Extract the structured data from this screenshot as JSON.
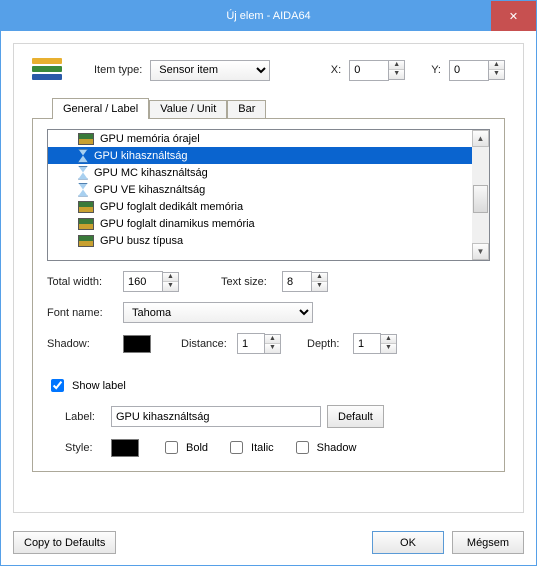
{
  "window": {
    "title": "Új elem - AIDA64"
  },
  "top": {
    "item_type_label": "Item type:",
    "item_type_value": "Sensor item",
    "x_label": "X:",
    "x_value": "0",
    "y_label": "Y:",
    "y_value": "0"
  },
  "tabs": {
    "general": "General / Label",
    "value": "Value / Unit",
    "bar": "Bar"
  },
  "list": {
    "items": [
      {
        "icon": "chip",
        "label": "GPU memória órajel"
      },
      {
        "icon": "hour",
        "label": "GPU kihasználtság",
        "selected": true
      },
      {
        "icon": "hour",
        "label": "GPU MC kihasználtság"
      },
      {
        "icon": "hour",
        "label": "GPU VE kihasználtság"
      },
      {
        "icon": "chip",
        "label": "GPU foglalt dedikált memória"
      },
      {
        "icon": "chip",
        "label": "GPU foglalt dinamikus memória"
      },
      {
        "icon": "chip",
        "label": "GPU busz típusa"
      }
    ]
  },
  "fields": {
    "total_width_label": "Total width:",
    "total_width_value": "160",
    "text_size_label": "Text size:",
    "text_size_value": "8",
    "font_name_label": "Font name:",
    "font_name_value": "Tahoma",
    "shadow_label": "Shadow:",
    "distance_label": "Distance:",
    "distance_value": "1",
    "depth_label": "Depth:",
    "depth_value": "1",
    "show_label": "Show label",
    "label_label": "Label:",
    "label_value": "GPU kihasználtság",
    "default_btn": "Default",
    "style_label": "Style:",
    "bold": "Bold",
    "italic": "Italic",
    "shadow_chk": "Shadow"
  },
  "footer": {
    "copy": "Copy to Defaults",
    "ok": "OK",
    "cancel": "Mégsem"
  }
}
